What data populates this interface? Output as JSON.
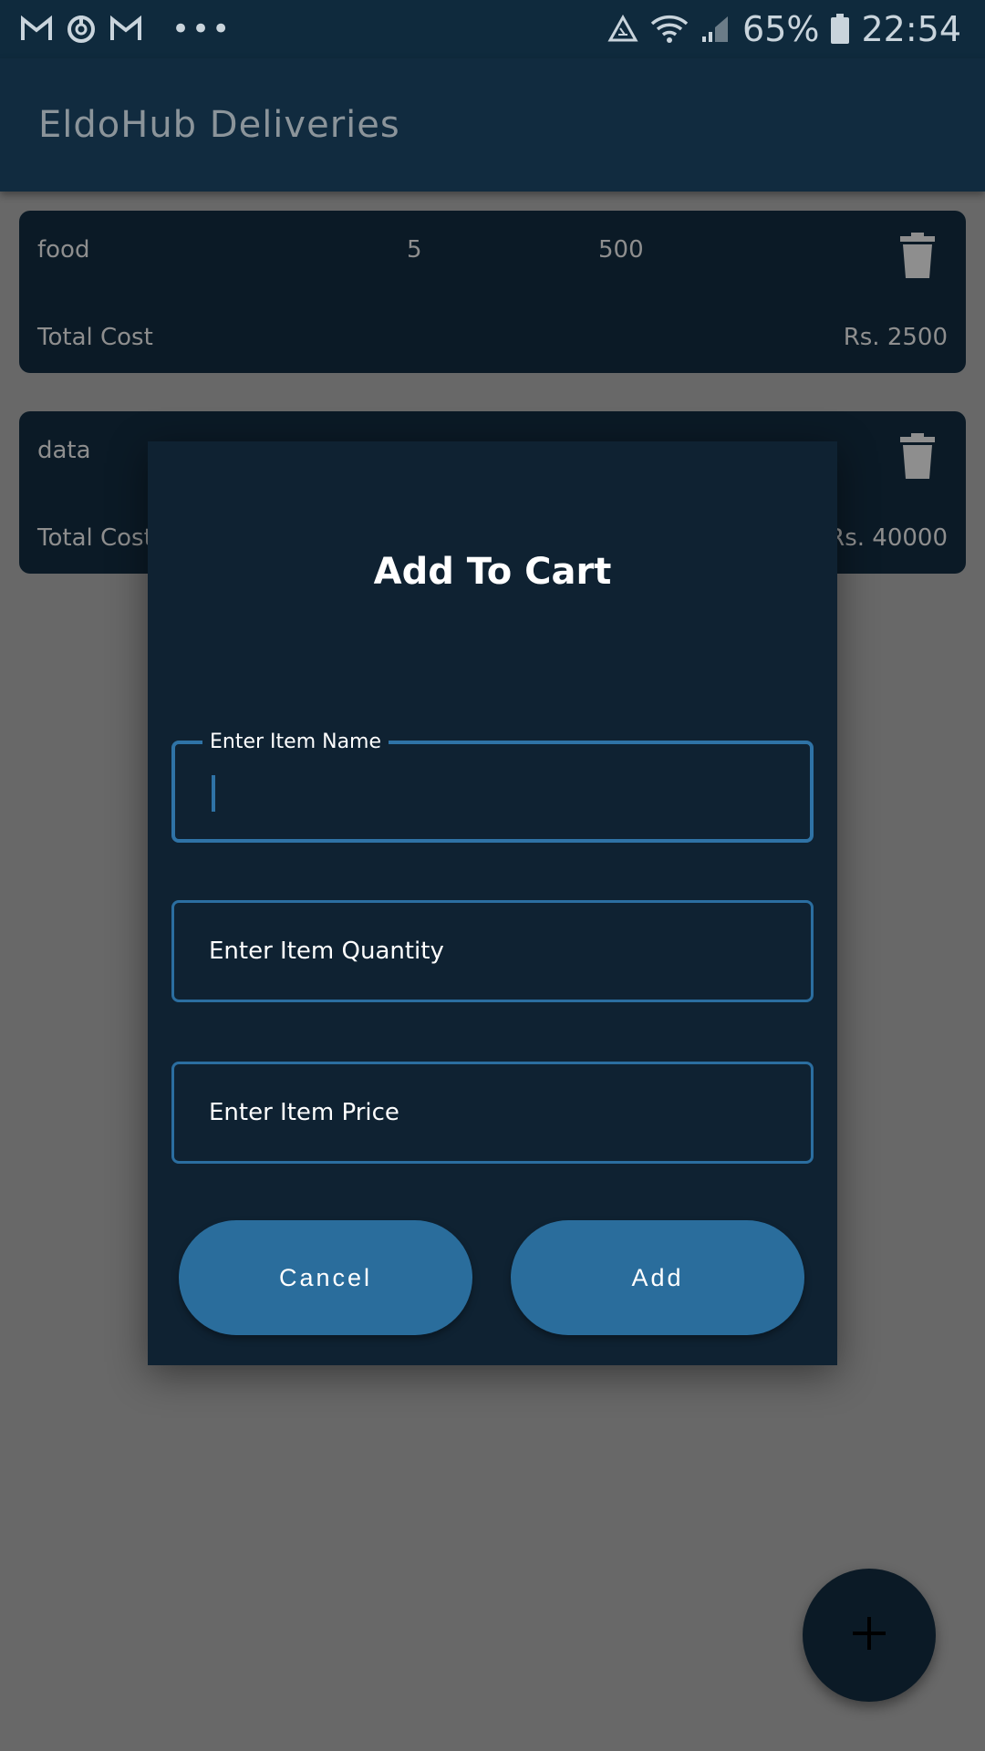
{
  "status_bar": {
    "icons": [
      "gmail-icon",
      "sync-icon",
      "gmail-icon",
      "more-icon",
      "recycle-icon",
      "wifi-icon",
      "signal-icon",
      "battery-icon"
    ],
    "more": "•••",
    "battery": "65%",
    "time": "22:54"
  },
  "app_bar": {
    "title": "EldoHub Deliveries"
  },
  "cart_items": [
    {
      "name": "food",
      "quantity": "5",
      "price": "500",
      "total_label": "Total Cost",
      "total_value": "Rs. 2500"
    },
    {
      "name": "data",
      "quantity": "",
      "price": "",
      "total_label": "Total Cost",
      "total_value": "Rs. 40000"
    }
  ],
  "dialog": {
    "title": "Add To Cart",
    "name_field": {
      "label": "Enter Item Name",
      "value": ""
    },
    "quantity_field": {
      "placeholder": "Enter Item Quantity"
    },
    "price_field": {
      "placeholder": "Enter Item Price"
    },
    "cancel_label": "Cancel",
    "add_label": "Add"
  },
  "colors": {
    "app_bar": "#112b3f",
    "card": "#0b1a26",
    "dialog": "#0f2232",
    "accent": "#2a6d9c",
    "scrim": "#686868"
  }
}
